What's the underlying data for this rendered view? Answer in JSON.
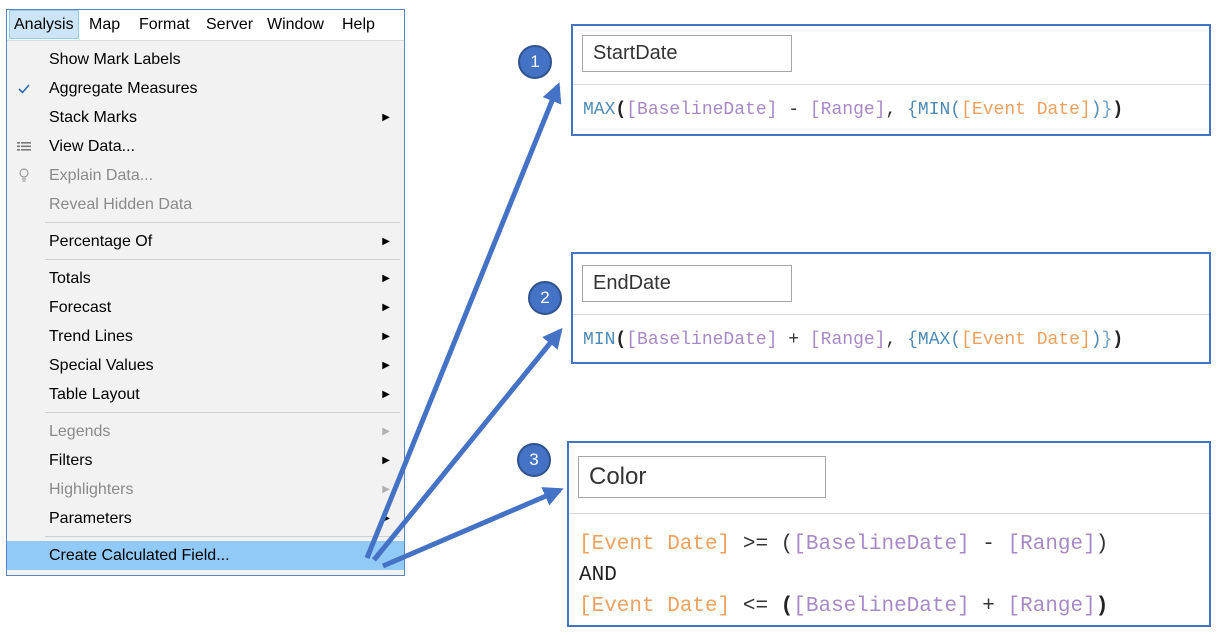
{
  "menubar": {
    "items": [
      "Analysis",
      "Map",
      "Format",
      "Server",
      "Window",
      "Help"
    ],
    "active": "Analysis"
  },
  "dropdown": {
    "items": [
      {
        "label": "Show Mark Labels",
        "icon": "",
        "submenu": false,
        "disabled": false
      },
      {
        "label": "Aggregate Measures",
        "icon": "checkmark-icon",
        "submenu": false,
        "disabled": false
      },
      {
        "label": "Stack Marks",
        "icon": "",
        "submenu": true,
        "disabled": false
      },
      {
        "label": "View Data...",
        "icon": "view-data-icon",
        "submenu": false,
        "disabled": false
      },
      {
        "label": "Explain Data...",
        "icon": "lightbulb-icon",
        "submenu": false,
        "disabled": true
      },
      {
        "label": "Reveal Hidden Data",
        "icon": "",
        "submenu": false,
        "disabled": true
      },
      {
        "label": "Percentage Of",
        "icon": "",
        "submenu": true,
        "disabled": false
      },
      {
        "label": "Totals",
        "icon": "",
        "submenu": true,
        "disabled": false
      },
      {
        "label": "Forecast",
        "icon": "",
        "submenu": true,
        "disabled": false
      },
      {
        "label": "Trend Lines",
        "icon": "",
        "submenu": true,
        "disabled": false
      },
      {
        "label": "Special Values",
        "icon": "",
        "submenu": true,
        "disabled": false
      },
      {
        "label": "Table Layout",
        "icon": "",
        "submenu": true,
        "disabled": false
      },
      {
        "label": "Legends",
        "icon": "",
        "submenu": true,
        "disabled": true
      },
      {
        "label": "Filters",
        "icon": "",
        "submenu": true,
        "disabled": false
      },
      {
        "label": "Highlighters",
        "icon": "",
        "submenu": true,
        "disabled": true
      },
      {
        "label": "Parameters",
        "icon": "",
        "submenu": true,
        "disabled": false
      },
      {
        "label": "Create Calculated Field...",
        "icon": "",
        "submenu": false,
        "disabled": false,
        "highlighted": true
      }
    ]
  },
  "calcs": [
    {
      "step": "1",
      "name": "StartDate",
      "formula": [
        "MAX",
        "(",
        "[BaselineDate]",
        " - ",
        "[Range]",
        ", ",
        "{MIN(",
        "[Event Date]",
        ")",
        "}",
        ")"
      ]
    },
    {
      "step": "2",
      "name": "EndDate",
      "formula": [
        "MIN",
        "(",
        "[BaselineDate]",
        " + ",
        "[Range]",
        ", ",
        "{MAX(",
        "[Event Date]",
        ")",
        "}",
        ")"
      ]
    },
    {
      "step": "3",
      "name": "Color",
      "formula_lines": [
        [
          "[Event Date]",
          " >= ",
          "(",
          "[BaselineDate]",
          " - ",
          "[Range]",
          ")"
        ],
        [
          "AND"
        ],
        [
          "[Event Date]",
          " <= ",
          "(",
          "[BaselineDate]",
          " + ",
          "[Range]",
          ")"
        ]
      ]
    }
  ],
  "colors": {
    "accent": "#4472c4",
    "menu_highlight": "#91c9f7",
    "function": "#4e8ab5",
    "parameter": "#a68ac8",
    "field": "#f0a060"
  }
}
